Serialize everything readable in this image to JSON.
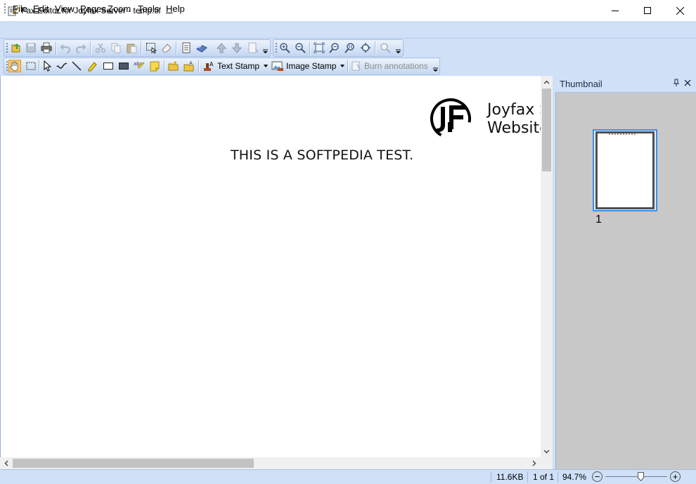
{
  "window": {
    "title": "Fax Editor for Joyfax Server - temp.tif",
    "icon": "fax-editor-app-icon",
    "controls": [
      "minimize-icon",
      "maximize-icon",
      "close-icon"
    ]
  },
  "menu": {
    "items": [
      {
        "label": "File"
      },
      {
        "label": "Edit"
      },
      {
        "label": "View"
      },
      {
        "label": "Pages"
      },
      {
        "label": "Zoom"
      },
      {
        "label": "Tools"
      },
      {
        "label": "Help"
      }
    ]
  },
  "toolbar1": {
    "file_icons": [
      "open-icon",
      "save-icon",
      "print-icon"
    ],
    "edit_icons": [
      "undo-icon",
      "redo-icon",
      "cut-icon",
      "copy-icon",
      "paste-icon"
    ],
    "select_icons": [
      "select-all-icon",
      "eraser-icon"
    ],
    "page_icons": [
      "page-properties-icon",
      "scan-icon",
      "page-up-icon",
      "page-down-icon",
      "insert-page-icon"
    ],
    "zoom_icons": [
      "zoom-in-icon",
      "zoom-out-icon",
      "fit-page-icon",
      "fit-width-icon",
      "actual-size-icon",
      "fit-height-icon",
      "zoom-tool-icon"
    ]
  },
  "toolbar2": {
    "tool_icons": [
      "hand-tool-icon",
      "rectangle-select-icon",
      "pointer-icon",
      "freehand-icon",
      "line-icon",
      "highlighter-icon",
      "rectangle-icon",
      "filled-rectangle-icon",
      "text-annotation-icon",
      "sticky-note-icon",
      "open-folder-icon",
      "text-folder-icon"
    ],
    "text_stamp_label": "Text Stamp",
    "image_stamp_label": "Image Stamp",
    "burn_label": "Burn annotations"
  },
  "document": {
    "company_line1": "Joyfax S",
    "company_line2": "Website",
    "body_text": "THIS IS A SOFTPEDIA TEST."
  },
  "thumbnail_panel": {
    "title": "Thumbnail",
    "pages": [
      {
        "label": "1",
        "selected": true
      }
    ]
  },
  "status": {
    "file_size": "11.6KB",
    "page_info": "1 of 1",
    "zoom": "94.7%",
    "zoom_out_symbol": "−",
    "zoom_in_symbol": "+"
  },
  "colors": {
    "chrome": "#cfe0f7",
    "toolbar_border": "#a9c0e2",
    "thumbnail_bg": "#c8c8c8",
    "selection": "#3b8ee8"
  }
}
